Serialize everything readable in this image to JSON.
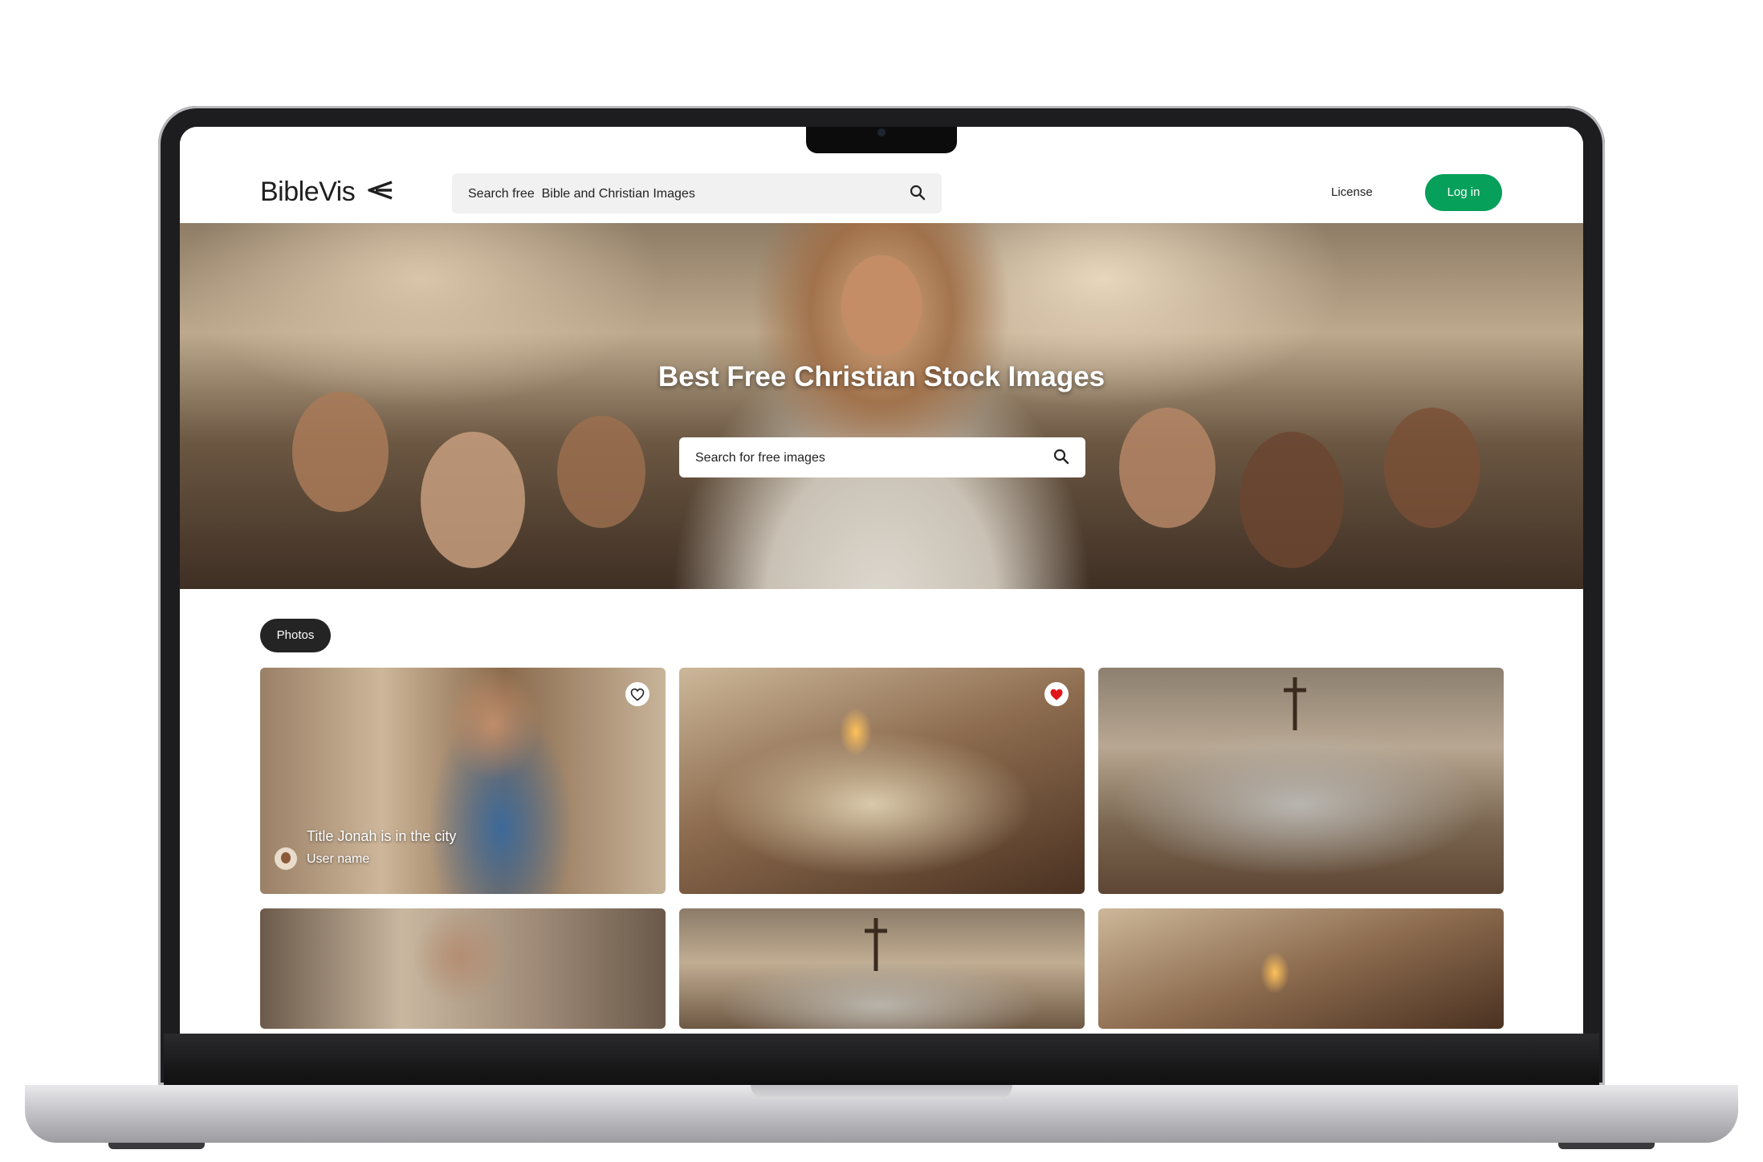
{
  "header": {
    "logo_text": "BibleVis",
    "search_placeholder": "Search free  Bible and Christian Images",
    "license_label": "License",
    "login_label": "Log in",
    "login_color": "#07a05b"
  },
  "hero": {
    "title": "Best Free Christian Stock Images",
    "search_placeholder": "Search for free images"
  },
  "tabs": [
    {
      "label": "Photos",
      "active": true
    }
  ],
  "grid": {
    "cards": [
      {
        "title": "Title Jonah is in the city",
        "user": "User name",
        "liked": false,
        "heart_icon": "heart-outline-icon"
      },
      {
        "title": "",
        "user": "",
        "liked": true,
        "heart_icon": "heart-filled-icon",
        "heart_color": "#e0161b"
      },
      {
        "title": "",
        "user": "",
        "liked": false
      },
      {
        "title": "",
        "user": "",
        "liked": false
      },
      {
        "title": "",
        "user": "",
        "liked": false
      },
      {
        "title": "",
        "user": "",
        "liked": false
      }
    ]
  }
}
